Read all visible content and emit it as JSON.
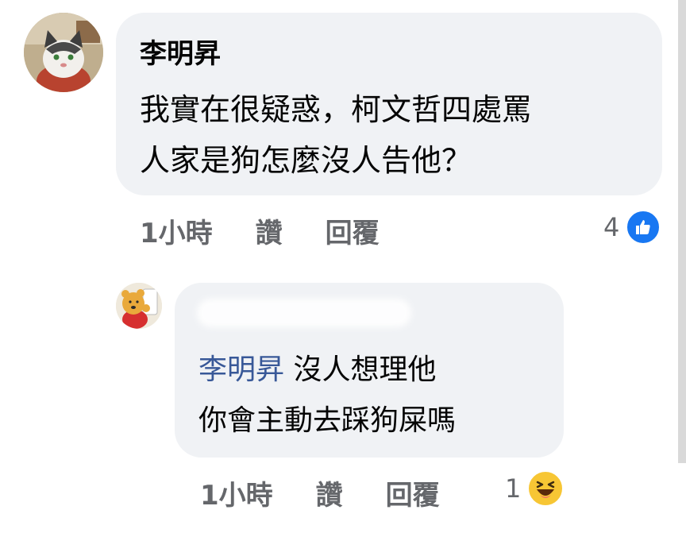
{
  "comment": {
    "author": "李明昇",
    "text": "我實在很疑惑，柯文哲四處罵\n人家是狗怎麼沒人告他？",
    "time": "1小時",
    "like_label": "讚",
    "reply_label": "回覆",
    "reaction_count": "4",
    "reaction_icon": "like-icon",
    "accent": "#1877f2"
  },
  "reply": {
    "mention": "李明昇",
    "text_line1": " 沒人想理他",
    "text_line2": "你會主動去踩狗屎嗎",
    "time": "1小時",
    "like_label": "讚",
    "reply_label": "回覆",
    "reaction_count": "1",
    "reaction_icon": "haha-icon",
    "mention_color": "#385898"
  }
}
